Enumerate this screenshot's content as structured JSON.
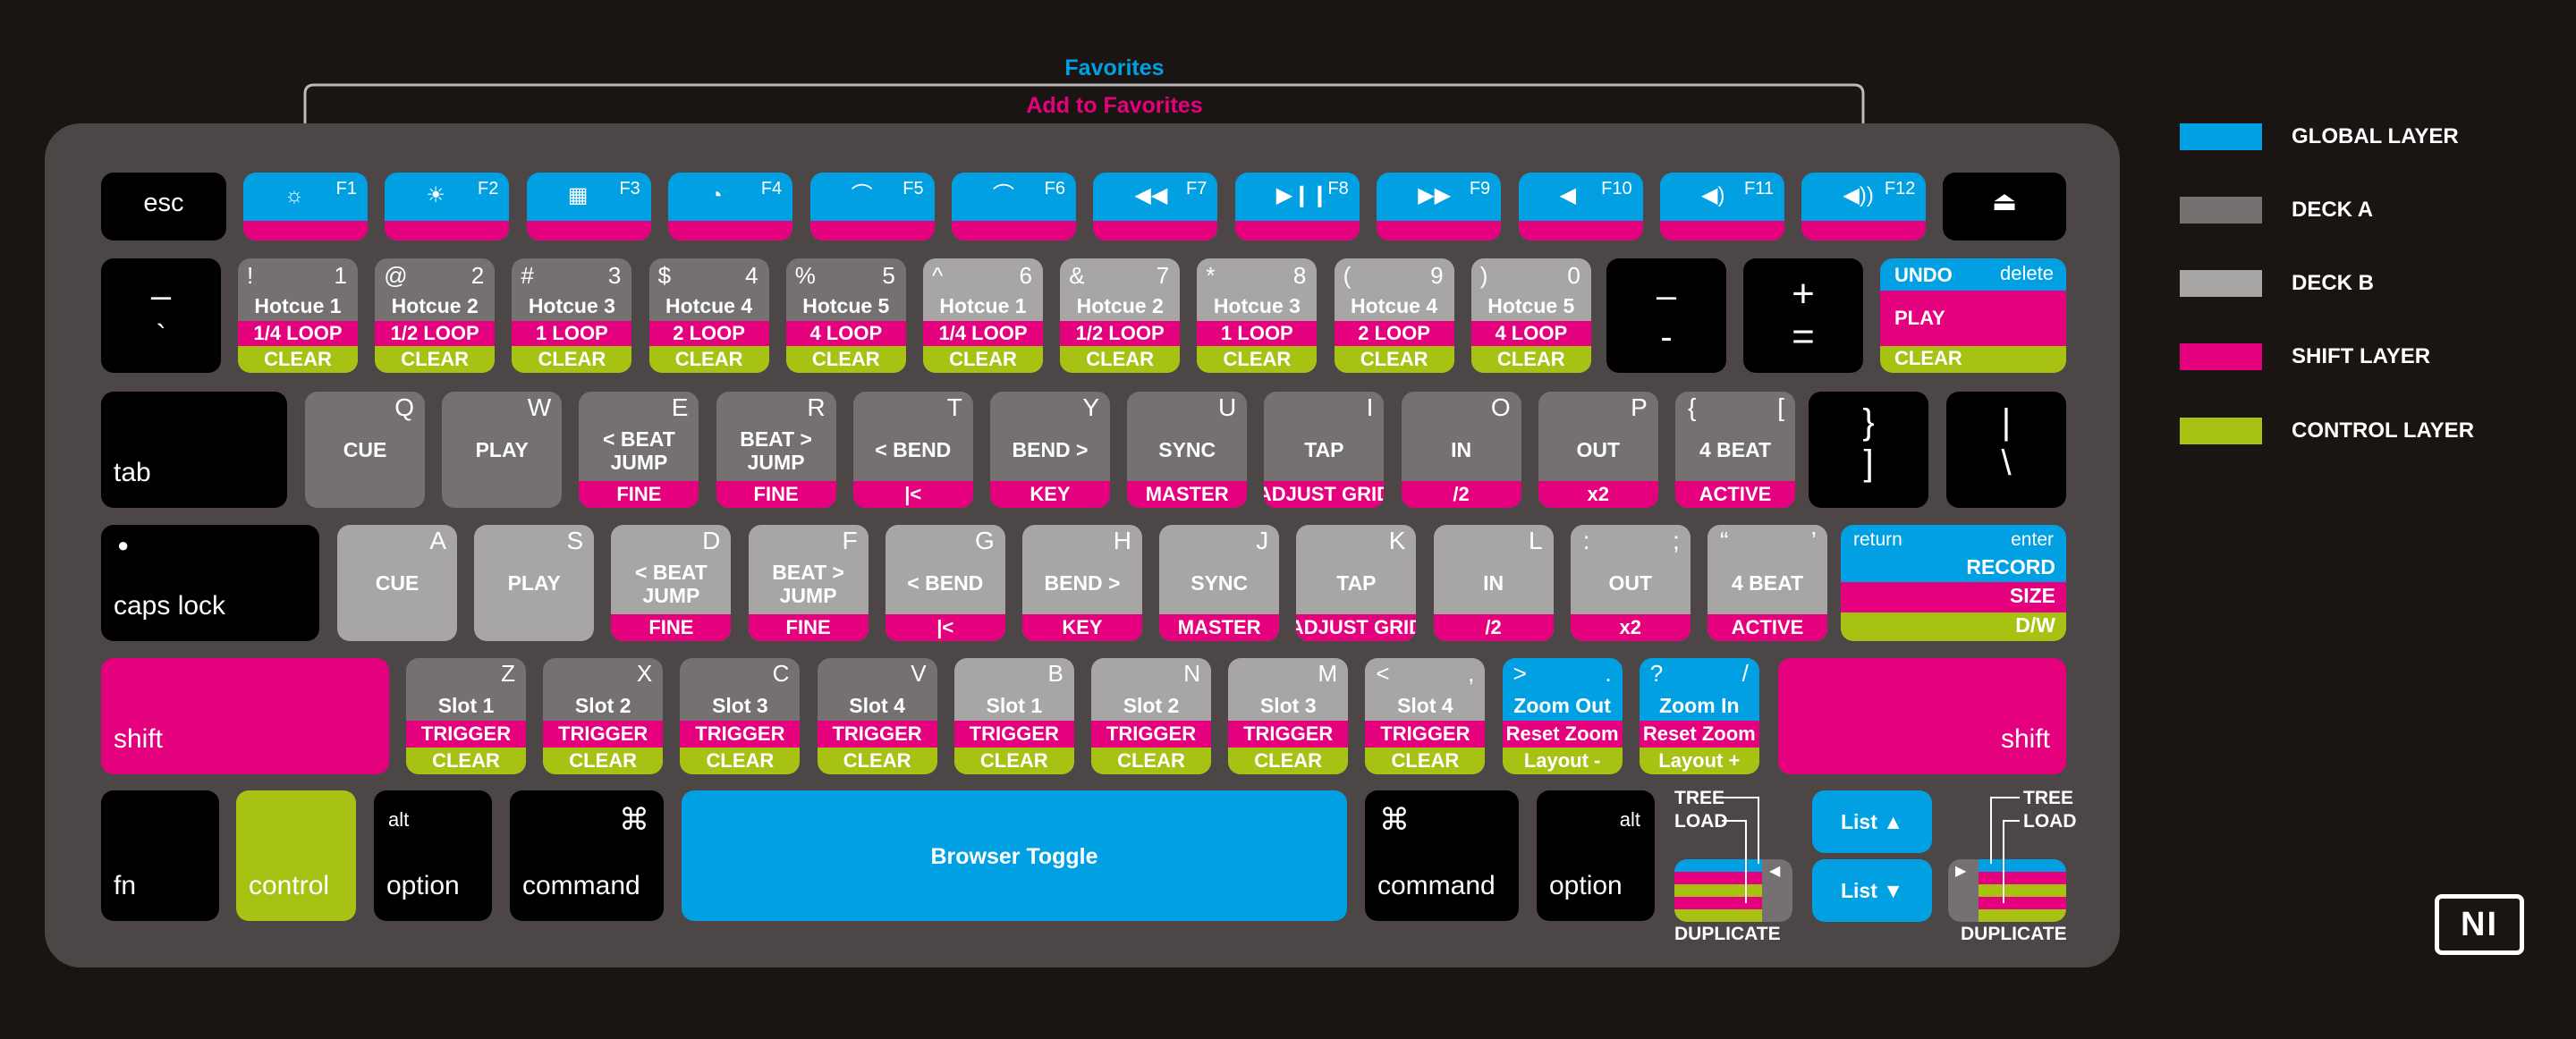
{
  "header": {
    "favorites": "Favorites",
    "add_to_favorites": "Add to Favorites"
  },
  "colors": {
    "global": "#00a0e3",
    "deck_a": "#747170",
    "deck_b": "#a8a6a5",
    "shift": "#e5007d",
    "control": "#a8c214"
  },
  "legend": [
    {
      "label": "GLOBAL LAYER",
      "color": "#00a0e3"
    },
    {
      "label": "DECK A",
      "color": "#747170"
    },
    {
      "label": "DECK B",
      "color": "#a8a6a5"
    },
    {
      "label": "SHIFT LAYER",
      "color": "#e5007d"
    },
    {
      "label": "CONTROL LAYER",
      "color": "#a8c214"
    }
  ],
  "fn_row": {
    "esc": "esc",
    "eject": "⏏",
    "keys": [
      {
        "label": "F1",
        "icon": "☼"
      },
      {
        "label": "F2",
        "icon": "☀"
      },
      {
        "label": "F3",
        "icon": "▦"
      },
      {
        "label": "F4",
        "icon": "◔"
      },
      {
        "label": "F5",
        "icon": "⌒"
      },
      {
        "label": "F6",
        "icon": "⌒"
      },
      {
        "label": "F7",
        "icon": "◀◀"
      },
      {
        "label": "F8",
        "icon": "▶❙❙"
      },
      {
        "label": "F9",
        "icon": "▶▶"
      },
      {
        "label": "F10",
        "icon": "◀"
      },
      {
        "label": "F11",
        "icon": "◀)"
      },
      {
        "label": "F12",
        "icon": "◀))"
      }
    ]
  },
  "num_row": {
    "tilde": {
      "top": "–",
      "bottom": "`"
    },
    "keys": [
      {
        "sym": "!",
        "num": "1",
        "main": "Hotcue 1",
        "shift": "1/4 LOOP",
        "ctrl": "CLEAR"
      },
      {
        "sym": "@",
        "num": "2",
        "main": "Hotcue 2",
        "shift": "1/2 LOOP",
        "ctrl": "CLEAR"
      },
      {
        "sym": "#",
        "num": "3",
        "main": "Hotcue 3",
        "shift": "1 LOOP",
        "ctrl": "CLEAR"
      },
      {
        "sym": "$",
        "num": "4",
        "main": "Hotcue 4",
        "shift": "2 LOOP",
        "ctrl": "CLEAR"
      },
      {
        "sym": "%",
        "num": "5",
        "main": "Hotcue 5",
        "shift": "4 LOOP",
        "ctrl": "CLEAR"
      },
      {
        "sym": "^",
        "num": "6",
        "main": "Hotcue 1",
        "shift": "1/4 LOOP",
        "ctrl": "CLEAR"
      },
      {
        "sym": "&",
        "num": "7",
        "main": "Hotcue 2",
        "shift": "1/2 LOOP",
        "ctrl": "CLEAR"
      },
      {
        "sym": "*",
        "num": "8",
        "main": "Hotcue 3",
        "shift": "1 LOOP",
        "ctrl": "CLEAR"
      },
      {
        "sym": "(",
        "num": "9",
        "main": "Hotcue 4",
        "shift": "2 LOOP",
        "ctrl": "CLEAR"
      },
      {
        "sym": ")",
        "num": "0",
        "main": "Hotcue 5",
        "shift": "4 LOOP",
        "ctrl": "CLEAR"
      }
    ],
    "minus": {
      "top": "–",
      "bottom": "-"
    },
    "plus": {
      "top": "+",
      "bottom": "="
    },
    "delete": {
      "undo": "UNDO",
      "delete": "delete",
      "play": "PLAY",
      "clear": "CLEAR"
    }
  },
  "q_row": {
    "tab": "tab",
    "keys": [
      {
        "letter": "Q",
        "main": "CUE",
        "shift": ""
      },
      {
        "letter": "W",
        "main": "PLAY",
        "shift": ""
      },
      {
        "letter": "E",
        "main": "< BEAT\nJUMP",
        "shift": "FINE"
      },
      {
        "letter": "R",
        "main": "BEAT >\nJUMP",
        "shift": "FINE"
      },
      {
        "letter": "T",
        "main": "< BEND",
        "shift": "|<"
      },
      {
        "letter": "Y",
        "main": "BEND >",
        "shift": "KEY"
      },
      {
        "letter": "U",
        "main": "SYNC",
        "shift": "MASTER"
      },
      {
        "letter": "I",
        "main": "TAP",
        "shift": "ADJUST GRID"
      },
      {
        "letter": "O",
        "main": "IN",
        "shift": "/2"
      },
      {
        "letter": "P",
        "main": "OUT",
        "shift": "x2"
      },
      {
        "letter": "[",
        "sym": "{",
        "main": "4 BEAT",
        "shift": "ACTIVE"
      }
    ],
    "bracket": {
      "top": "}",
      "bottom": "]"
    },
    "backslash": {
      "top": "|",
      "bottom": "\\"
    }
  },
  "a_row": {
    "caps": "caps lock",
    "keys": [
      {
        "letter": "A",
        "main": "CUE",
        "shift": ""
      },
      {
        "letter": "S",
        "main": "PLAY",
        "shift": ""
      },
      {
        "letter": "D",
        "main": "< BEAT\nJUMP",
        "shift": "FINE"
      },
      {
        "letter": "F",
        "main": "BEAT >\nJUMP",
        "shift": "FINE"
      },
      {
        "letter": "G",
        "main": "< BEND",
        "shift": "|<"
      },
      {
        "letter": "H",
        "main": "BEND >",
        "shift": "KEY"
      },
      {
        "letter": "J",
        "main": "SYNC",
        "shift": "MASTER"
      },
      {
        "letter": "K",
        "main": "TAP",
        "shift": "ADJUST GRID"
      },
      {
        "letter": "L",
        "main": "IN",
        "shift": "/2"
      },
      {
        "letter": ";",
        "sym": ":",
        "main": "OUT",
        "shift": "x2"
      },
      {
        "letter": "’",
        "sym": "“",
        "main": "4 BEAT",
        "shift": "ACTIVE"
      }
    ],
    "return": {
      "return": "return",
      "enter": "enter",
      "record": "RECORD",
      "size": "SIZE",
      "dw": "D/W"
    }
  },
  "z_row": {
    "shift": "shift",
    "keys": [
      {
        "letter": "Z",
        "main": "Slot 1",
        "shift": "TRIGGER",
        "ctrl": "CLEAR"
      },
      {
        "letter": "X",
        "main": "Slot 2",
        "shift": "TRIGGER",
        "ctrl": "CLEAR"
      },
      {
        "letter": "C",
        "main": "Slot 3",
        "shift": "TRIGGER",
        "ctrl": "CLEAR"
      },
      {
        "letter": "V",
        "main": "Slot 4",
        "shift": "TRIGGER",
        "ctrl": "CLEAR"
      },
      {
        "letter": "B",
        "main": "Slot 1",
        "shift": "TRIGGER",
        "ctrl": "CLEAR"
      },
      {
        "letter": "N",
        "main": "Slot 2",
        "shift": "TRIGGER",
        "ctrl": "CLEAR"
      },
      {
        "letter": "M",
        "main": "Slot 3",
        "shift": "TRIGGER",
        "ctrl": "CLEAR"
      },
      {
        "letter": ",",
        "sym": "<",
        "main": "Slot 4",
        "shift": "TRIGGER",
        "ctrl": "CLEAR"
      }
    ],
    "zoom_out": {
      "sym": ">",
      "letter": ".",
      "main": "Zoom Out",
      "shift": "Reset Zoom",
      "ctrl": "Layout -"
    },
    "zoom_in": {
      "sym": "?",
      "letter": "/",
      "main": "Zoom In",
      "shift": "Reset Zoom",
      "ctrl": "Layout +"
    }
  },
  "bottom_row": {
    "fn": "fn",
    "control": "control",
    "option": "option",
    "alt": "alt",
    "command": "command",
    "cmd_symbol": "⌘",
    "space": "Browser Toggle",
    "list_up": "List ▲",
    "list_down": "List ▼",
    "tree": "TREE",
    "load": "LOAD",
    "duplicate": "DUPLICATE"
  },
  "logo": "NI"
}
